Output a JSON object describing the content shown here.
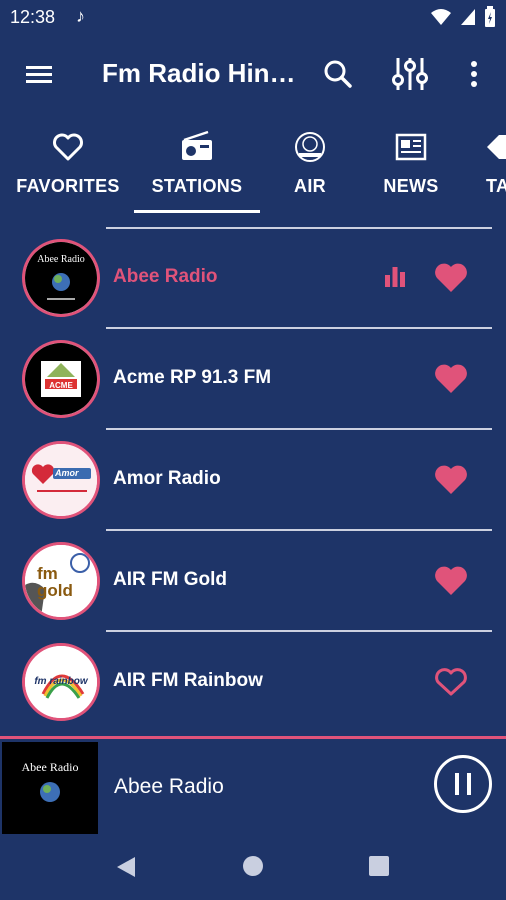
{
  "status_bar": {
    "time": "12:38",
    "icons": [
      "music-note-icon",
      "wifi-icon",
      "signal-icon",
      "battery-icon"
    ]
  },
  "app_bar": {
    "title": "Fm Radio Hin…",
    "icons": [
      "menu-icon",
      "search-icon",
      "equalizer-icon",
      "more-vert-icon"
    ]
  },
  "tabs": [
    {
      "label": "FAVORITES",
      "icon": "heart-outline-icon",
      "selected": false
    },
    {
      "label": "STATIONS",
      "icon": "radio-icon",
      "selected": true
    },
    {
      "label": "AIR",
      "icon": "air-logo-icon",
      "selected": false
    },
    {
      "label": "NEWS",
      "icon": "newspaper-icon",
      "selected": false
    },
    {
      "label": "TA",
      "icon": "tag-icon",
      "selected": false
    }
  ],
  "stations": [
    {
      "name": "Abee Radio",
      "playing": true,
      "favorite": true,
      "logo_text": "Abee Radio"
    },
    {
      "name": "Acme RP 91.3 FM",
      "playing": false,
      "favorite": true,
      "logo_text": "ACME"
    },
    {
      "name": "Amor Radio",
      "playing": false,
      "favorite": true,
      "logo_text": "Amor"
    },
    {
      "name": "AIR FM Gold",
      "playing": false,
      "favorite": true,
      "logo_text": "fm gold"
    },
    {
      "name": "AIR FM Rainbow",
      "playing": false,
      "favorite": false,
      "logo_text": "fm rainbow"
    }
  ],
  "player": {
    "station_name": "Abee Radio",
    "art_caption": "Abee Radio",
    "state": "playing"
  },
  "colors": {
    "background": "#1e3468",
    "accent": "#e0537a",
    "text": "#ffffff",
    "divider": "#ccd0e0"
  }
}
